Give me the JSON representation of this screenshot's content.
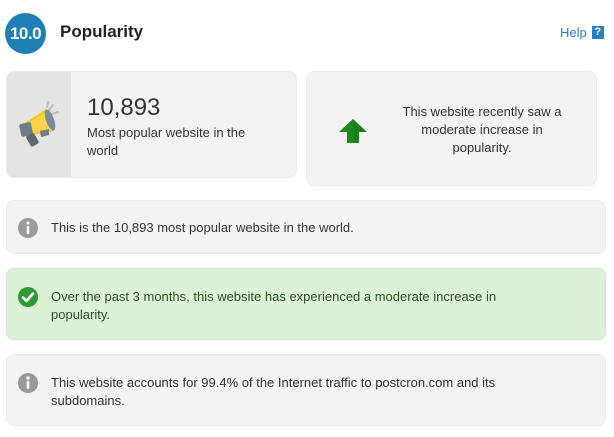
{
  "header": {
    "score": "10.0",
    "title": "Popularity",
    "help_label": "Help",
    "help_icon_glyph": "?"
  },
  "rank_card": {
    "icon": "megaphone-icon",
    "value": "10,893",
    "label": "Most popular website in the world"
  },
  "trend_card": {
    "icon": "arrow-up-icon",
    "text": "This website recently saw a moderate increase in popularity."
  },
  "messages": [
    {
      "icon": "info-icon",
      "text": "This is the 10,893 most popular website in the world."
    },
    {
      "icon": "check-icon",
      "text": "Over the past 3 months, this website has experienced a moderate increase in popularity."
    },
    {
      "icon": "info-icon",
      "text": "This website accounts for 99.4% of the Internet traffic to postcron.com and its subdomains."
    }
  ],
  "colors": {
    "badge": "#1d7fb5",
    "link": "#2a7fc1",
    "arrow": "#1e8a1e",
    "success_bg": "#dbf2d6",
    "success_icon": "#2e9a36",
    "info_icon": "#9a9a9a",
    "megaphone_yellow": "#f5c518"
  }
}
